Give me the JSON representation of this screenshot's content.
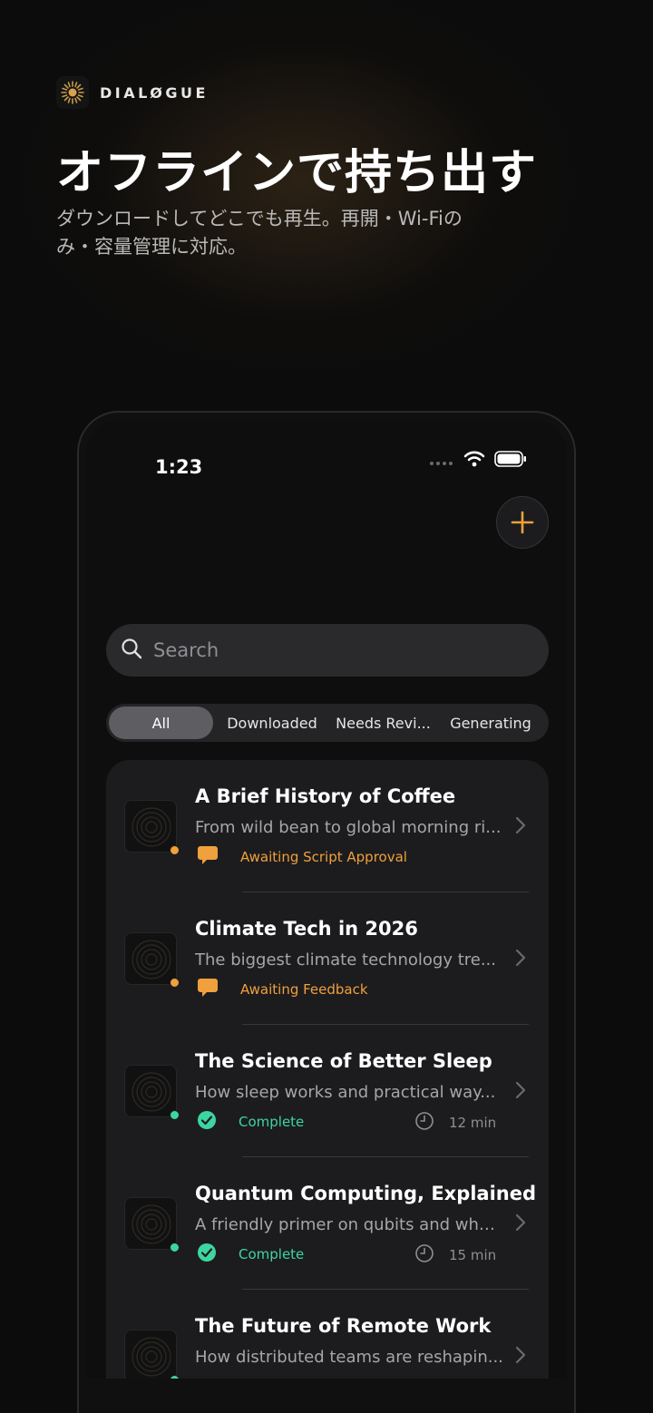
{
  "brand": {
    "name": "DIALØGUE",
    "logo_icon": "sunburst-logo-icon"
  },
  "hero": {
    "title": "オフラインで持ち出す",
    "subtitle": "ダウンロードしてどこでも再生。再開・Wi-Fiのみ・容量管理に対応。"
  },
  "status_bar": {
    "time": "1:23"
  },
  "search": {
    "placeholder": "Search"
  },
  "filters": [
    {
      "label": "All",
      "active": true
    },
    {
      "label": "Downloaded",
      "active": false
    },
    {
      "label": "Needs Revi...",
      "active": false
    },
    {
      "label": "Generating",
      "active": false
    }
  ],
  "colors": {
    "accent": "#F0A03C",
    "complete": "#3DD6A0",
    "pending": "#F0A03C"
  },
  "episodes": [
    {
      "title": "A Brief History of Coffee",
      "description": "From wild bean to global morning ri...",
      "status": "Awaiting Script Approval",
      "status_type": "pending",
      "duration": ""
    },
    {
      "title": "Climate Tech in 2026",
      "description": "The biggest climate technology tre...",
      "status": "Awaiting Feedback",
      "status_type": "pending",
      "duration": ""
    },
    {
      "title": "The Science of Better Sleep",
      "description": "How sleep works and practical way...",
      "status": "Complete",
      "status_type": "complete",
      "duration": "12 min"
    },
    {
      "title": "Quantum Computing, Explained",
      "description": "A friendly primer on qubits and wha...",
      "status": "Complete",
      "status_type": "complete",
      "duration": "15 min"
    },
    {
      "title": "The Future of Remote Work",
      "description": "How distributed teams are reshapin...",
      "status": "",
      "status_type": "complete",
      "duration": ""
    }
  ]
}
